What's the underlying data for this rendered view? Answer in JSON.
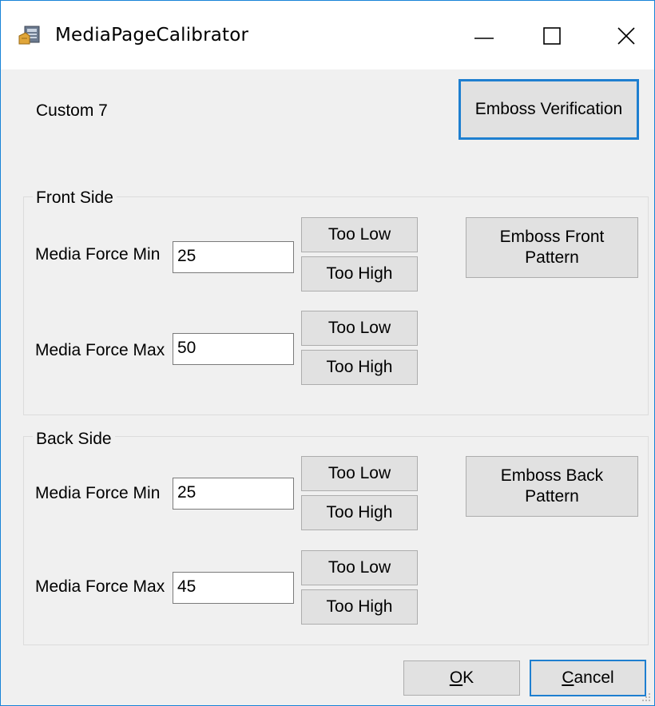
{
  "window": {
    "title": "MediaPageCalibrator",
    "app_icon": "calibrator-app-icon",
    "controls": {
      "minimize_icon": "minimize-icon",
      "maximize_icon": "maximize-icon",
      "close_icon": "close-icon"
    }
  },
  "header": {
    "profile_label": "Custom 7",
    "emboss_verification_label": "Emboss Verification"
  },
  "front_side": {
    "group_label": "Front Side",
    "min": {
      "label": "Media Force Min",
      "value": "25",
      "too_low_label": "Too Low",
      "too_high_label": "Too High"
    },
    "max": {
      "label": "Media Force Max",
      "value": "50",
      "too_low_label": "Too Low",
      "too_high_label": "Too High"
    },
    "emboss_button_line1": "Emboss Front",
    "emboss_button_line2": "Pattern"
  },
  "back_side": {
    "group_label": "Back Side",
    "min": {
      "label": "Media Force Min",
      "value": "25",
      "too_low_label": "Too Low",
      "too_high_label": "Too High"
    },
    "max": {
      "label": "Media Force Max",
      "value": "45",
      "too_low_label": "Too Low",
      "too_high_label": "Too High"
    },
    "emboss_button_line1": "Emboss Back",
    "emboss_button_line2": "Pattern"
  },
  "footer": {
    "ok_mnemonic": "O",
    "ok_rest": "K",
    "cancel_mnemonic": "C",
    "cancel_rest": "ancel"
  },
  "colors": {
    "window_border": "#1883d7",
    "dialog_background": "#f0f0f0",
    "button_face": "#e1e1e1",
    "default_button_border": "#1e7fd0"
  }
}
